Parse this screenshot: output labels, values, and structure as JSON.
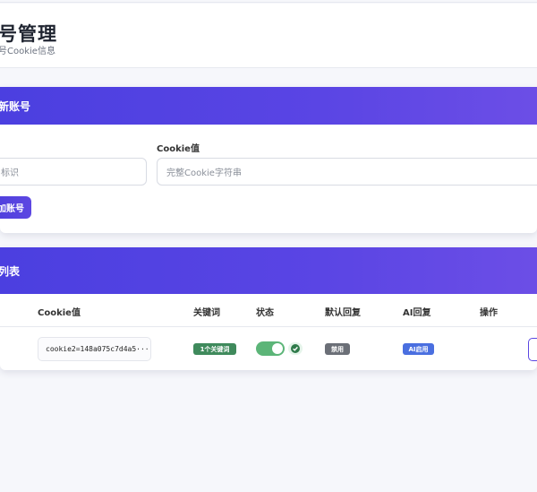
{
  "header": {
    "title": "号管理",
    "subtitle": "号Cookie信息"
  },
  "add_account": {
    "title": "新账号",
    "cookie_label": "Cookie值",
    "id_placeholder": "标识",
    "cookie_placeholder": "完整Cookie字符串",
    "add_button": "加账号"
  },
  "account_list": {
    "title": "列表",
    "columns": [
      "Cookie值",
      "关键词",
      "状态",
      "默认回复",
      "AI回复",
      "操作"
    ],
    "rows": [
      {
        "cookie": "cookie2=148a075c7d4a5···",
        "keywords": "1个关键词",
        "status_enabled": true,
        "default_reply": "禁用",
        "ai_reply": "AI启用"
      }
    ]
  },
  "colors": {
    "accent": "#5a45e4",
    "keyword_badge": "#3f8a5c",
    "disabled_badge": "#6b6f77",
    "ai_badge": "#4a6fe0",
    "toggle_on": "#5cb578"
  }
}
